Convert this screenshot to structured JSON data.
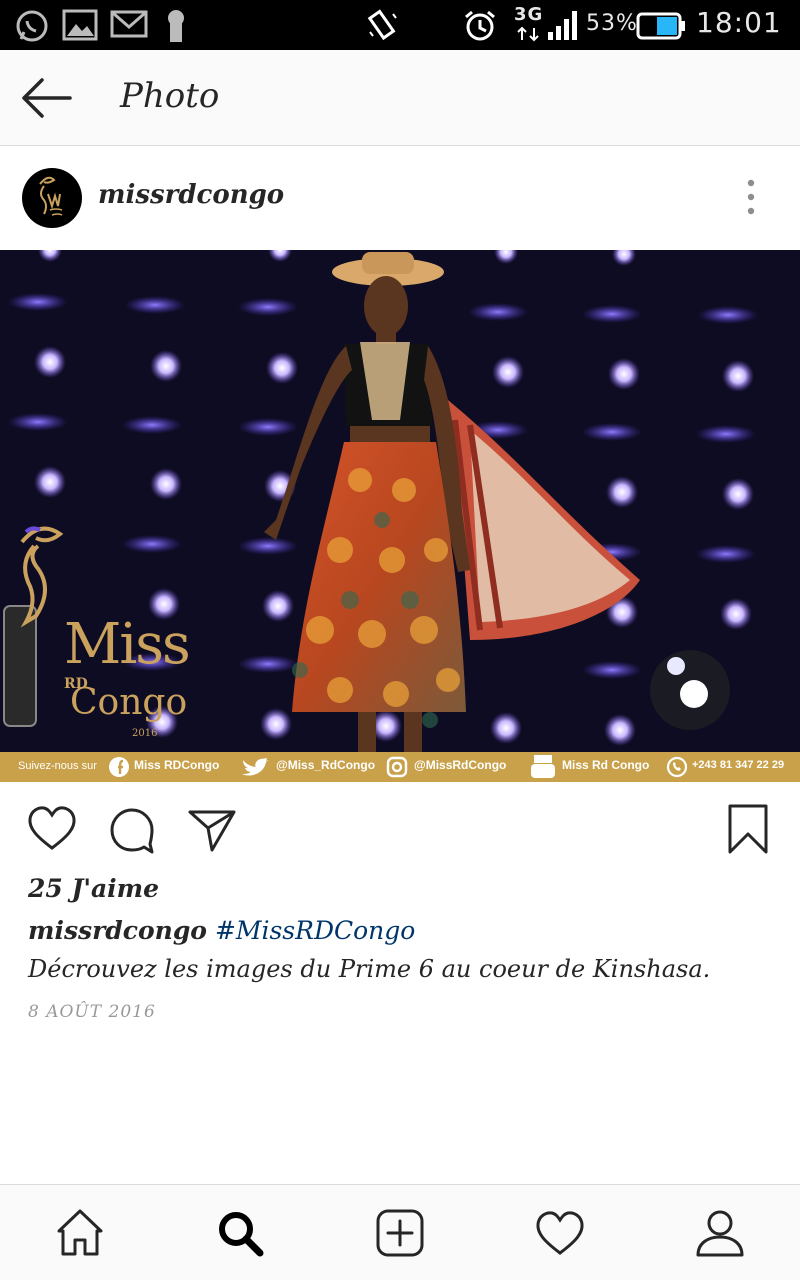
{
  "status_bar": {
    "network": "3G",
    "battery": "53%",
    "time": "18:01",
    "icons": [
      "whatsapp-icon",
      "gallery-icon",
      "gmail-icon",
      "keyhole-icon",
      "rotate-icon",
      "alarm-icon",
      "signal-icon",
      "battery-icon"
    ]
  },
  "header": {
    "title": "Photo",
    "back_icon": "arrow-left-icon"
  },
  "post": {
    "username": "missrdcongo",
    "more_icon": "more-vertical-icon",
    "likes": "25 J'aime",
    "caption_user": "missrdcongo",
    "hashtag": "#MissRDCongo",
    "caption_text": "Décrouvez les images du Prime 6 au coeur de Kinshasa.",
    "date": "8 AOÛT 2016"
  },
  "photo": {
    "logo_line1": "Miss",
    "logo_line2": "RD",
    "logo_line3": "Congo",
    "logo_year": "2016",
    "footer_lead": "Suivez-nous sur",
    "footer_items": [
      "Miss RDCongo",
      "@Miss_RdCongo",
      "@MissRdCongo",
      "Miss Rd Congo",
      "+243 81 347 22 29"
    ]
  },
  "actions": [
    "heart-icon",
    "comment-icon",
    "share-icon",
    "bookmark-icon"
  ],
  "bottom_nav": [
    "home-icon",
    "search-icon",
    "add-icon",
    "activity-icon",
    "profile-icon"
  ],
  "colors": {
    "text": "#262626",
    "hashtag": "#003569",
    "date": "#999999",
    "status_bar": "#000000",
    "photo_footer": "#c9a14a"
  }
}
